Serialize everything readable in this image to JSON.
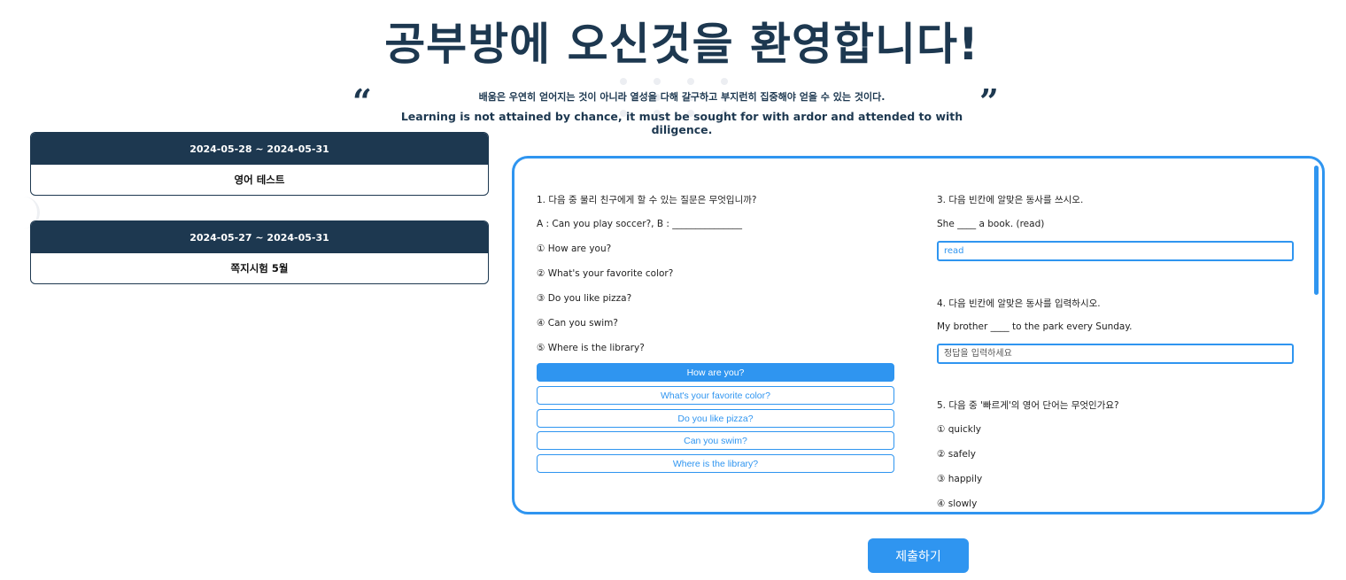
{
  "header": {
    "title": "공부방에 오신것을 환영합니다!",
    "quote_ko": "배움은 우연히 얻어지는 것이 아니라 열성을 다해 갈구하고 부지런히 집중해야 얻을 수 있는 것이다.",
    "quote_en": "Learning is not attained by chance, it must be sought for with ardor and attended to with diligence.",
    "open_quote": "“",
    "close_quote": "”"
  },
  "tests": [
    {
      "date_range": "2024-05-28 ~ 2024-05-31",
      "name": "영어 테스트"
    },
    {
      "date_range": "2024-05-27 ~ 2024-05-31",
      "name": "쪽지시험 5월"
    }
  ],
  "quiz": {
    "q1": {
      "question": "1. 다음 중 물리 친구에게 할 수 있는 질문은 무엇입니까?",
      "prompt": "A : Can you play soccer?, B : _______________",
      "choices": [
        "① How are you?",
        "② What's your favorite color?",
        "③ Do you like pizza?",
        "④ Can you swim?",
        "⑤ Where is the library?"
      ],
      "buttons": [
        "How are you?",
        "What's your favorite color?",
        "Do you like pizza?",
        "Can you swim?",
        "Where is the library?"
      ],
      "selected": "How are you?"
    },
    "q3": {
      "question": "3. 다음 빈칸에 알맞은 동사를 쓰시오.",
      "sentence": "She ____ a book. (read)",
      "value": "read"
    },
    "q4": {
      "question": "4. 다음 빈칸에 알맞은 동사를 입력하시오.",
      "sentence": "My brother ____ to the park every Sunday.",
      "placeholder": "정답을 입력하세요"
    },
    "q5": {
      "question": "5. 다음 중 '빠르게'의 영어 단어는 무엇인가요?",
      "choices": [
        "① quickly",
        "② safely",
        "③ happily",
        "④ slowly"
      ]
    }
  },
  "submit_label": "제출하기",
  "colors": {
    "accent": "#2f95f0",
    "navy": "#1d3850"
  }
}
